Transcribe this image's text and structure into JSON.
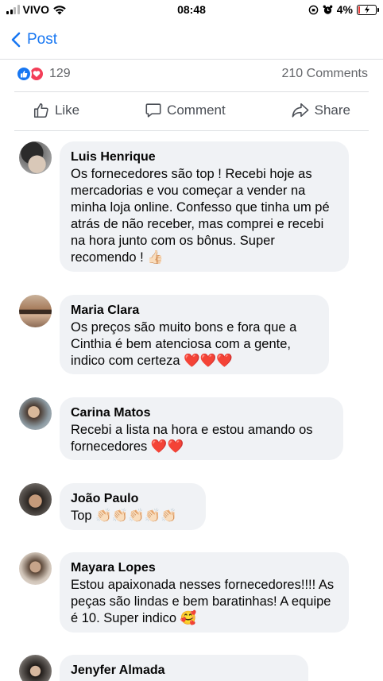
{
  "status_bar": {
    "carrier": "VIVO",
    "time": "08:48",
    "battery": "4%"
  },
  "nav": {
    "back_label": "Post"
  },
  "reactions": {
    "count": "129",
    "comments": "210 Comments"
  },
  "actions": {
    "like": "Like",
    "comment": "Comment",
    "share": "Share"
  },
  "colors": {
    "accent": "#1877f2",
    "love": "#f33e58",
    "bubble_bg": "#f0f2f5"
  },
  "comments": [
    {
      "author": "Luis Henrique",
      "text": "Os fornecedores são top ! Recebi hoje as mercadorias e vou começar a vender na minha loja online. Confesso que tinha um pé atrás de não receber, mas comprei e recebi na hora junto com os bônus. Super recomendo ! 👍🏻"
    },
    {
      "author": "Maria Clara",
      "text": "Os preços são muito bons e fora que a Cinthia é bem atenciosa com a gente, indico com certeza ❤️❤️❤️"
    },
    {
      "author": "Carina Matos",
      "text": "Recebi a lista na hora e estou amando os fornecedores ❤️❤️"
    },
    {
      "author": "João Paulo",
      "text": "Top 👏🏻👏🏻👏🏻👏🏻👏🏻"
    },
    {
      "author": "Mayara Lopes",
      "text": "Estou apaixonada nesses fornecedores!!!! As peças são lindas e bem baratinhas! A equipe é 10. Super indico 🥰"
    },
    {
      "author": "Jenyfer Almada",
      "text": ""
    }
  ]
}
